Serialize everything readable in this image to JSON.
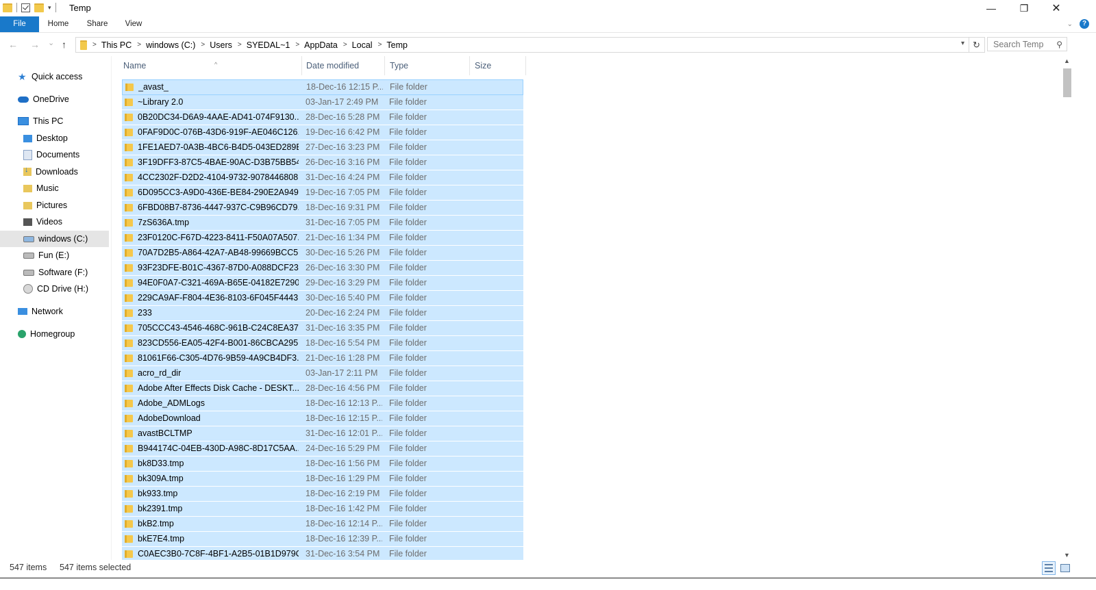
{
  "window": {
    "title": "Temp",
    "minimize": "—",
    "maximize": "❐",
    "close": "✕"
  },
  "ribbon": {
    "tabs": [
      "File",
      "Home",
      "Share",
      "View"
    ]
  },
  "nav": {
    "back": "←",
    "forward": "→",
    "recent": "⌄",
    "up": "↑"
  },
  "address": {
    "crumbs": [
      "This PC",
      "windows (C:)",
      "Users",
      "SYEDAL~1",
      "AppData",
      "Local",
      "Temp"
    ]
  },
  "search": {
    "placeholder": "Search Temp"
  },
  "sidebar": {
    "items": [
      {
        "label": "Quick access"
      },
      {
        "label": "OneDrive"
      },
      {
        "label": "This PC"
      },
      {
        "label": "Desktop"
      },
      {
        "label": "Documents"
      },
      {
        "label": "Downloads"
      },
      {
        "label": "Music"
      },
      {
        "label": "Pictures"
      },
      {
        "label": "Videos"
      },
      {
        "label": "windows (C:)"
      },
      {
        "label": "Fun (E:)"
      },
      {
        "label": "Software (F:)"
      },
      {
        "label": "CD Drive (H:)"
      },
      {
        "label": "Network"
      },
      {
        "label": "Homegroup"
      }
    ]
  },
  "columns": [
    "Name",
    "Date modified",
    "Type",
    "Size"
  ],
  "files": [
    {
      "name": "_avast_",
      "date": "18-Dec-16 12:15 P...",
      "type": "File folder"
    },
    {
      "name": "~Library 2.0",
      "date": "03-Jan-17 2:49 PM",
      "type": "File folder"
    },
    {
      "name": "0B20DC34-D6A9-4AAE-AD41-074F9130...",
      "date": "28-Dec-16 5:28 PM",
      "type": "File folder"
    },
    {
      "name": "0FAF9D0C-076B-43D6-919F-AE046C126...",
      "date": "19-Dec-16 6:42 PM",
      "type": "File folder"
    },
    {
      "name": "1FE1AED7-0A3B-4BC6-B4D5-043ED289B...",
      "date": "27-Dec-16 3:23 PM",
      "type": "File folder"
    },
    {
      "name": "3F19DFF3-87C5-4BAE-90AC-D3B75BB54...",
      "date": "26-Dec-16 3:16 PM",
      "type": "File folder"
    },
    {
      "name": "4CC2302F-D2D2-4104-9732-9078446808...",
      "date": "31-Dec-16 4:24 PM",
      "type": "File folder"
    },
    {
      "name": "6D095CC3-A9D0-436E-BE84-290E2A949...",
      "date": "19-Dec-16 7:05 PM",
      "type": "File folder"
    },
    {
      "name": "6FBD08B7-8736-4447-937C-C9B96CD79...",
      "date": "18-Dec-16 9:31 PM",
      "type": "File folder"
    },
    {
      "name": "7zS636A.tmp",
      "date": "31-Dec-16 7:05 PM",
      "type": "File folder"
    },
    {
      "name": "23F0120C-F67D-4223-8411-F50A07A507...",
      "date": "21-Dec-16 1:34 PM",
      "type": "File folder"
    },
    {
      "name": "70A7D2B5-A864-42A7-AB48-99669BCC5...",
      "date": "30-Dec-16 5:26 PM",
      "type": "File folder"
    },
    {
      "name": "93F23DFE-B01C-4367-87D0-A088DCF23...",
      "date": "26-Dec-16 3:30 PM",
      "type": "File folder"
    },
    {
      "name": "94E0F0A7-C321-469A-B65E-04182E7290...",
      "date": "29-Dec-16 3:29 PM",
      "type": "File folder"
    },
    {
      "name": "229CA9AF-F804-4E36-8103-6F045F4443...",
      "date": "30-Dec-16 5:40 PM",
      "type": "File folder"
    },
    {
      "name": "233",
      "date": "20-Dec-16 2:24 PM",
      "type": "File folder"
    },
    {
      "name": "705CCC43-4546-468C-961B-C24C8EA379...",
      "date": "31-Dec-16 3:35 PM",
      "type": "File folder"
    },
    {
      "name": "823CD556-EA05-42F4-B001-86CBCA295...",
      "date": "18-Dec-16 5:54 PM",
      "type": "File folder"
    },
    {
      "name": "81061F66-C305-4D76-9B59-4A9CB4DF3...",
      "date": "21-Dec-16 1:28 PM",
      "type": "File folder"
    },
    {
      "name": "acro_rd_dir",
      "date": "03-Jan-17 2:11 PM",
      "type": "File folder"
    },
    {
      "name": "Adobe After Effects Disk Cache - DESKT...",
      "date": "28-Dec-16 4:56 PM",
      "type": "File folder"
    },
    {
      "name": "Adobe_ADMLogs",
      "date": "18-Dec-16 12:13 P...",
      "type": "File folder"
    },
    {
      "name": "AdobeDownload",
      "date": "18-Dec-16 12:15 P...",
      "type": "File folder"
    },
    {
      "name": "avastBCLTMP",
      "date": "31-Dec-16 12:01 P...",
      "type": "File folder"
    },
    {
      "name": "B944174C-04EB-430D-A98C-8D17C5AA...",
      "date": "24-Dec-16 5:29 PM",
      "type": "File folder"
    },
    {
      "name": "bk8D33.tmp",
      "date": "18-Dec-16 1:56 PM",
      "type": "File folder"
    },
    {
      "name": "bk309A.tmp",
      "date": "18-Dec-16 1:29 PM",
      "type": "File folder"
    },
    {
      "name": "bk933.tmp",
      "date": "18-Dec-16 2:19 PM",
      "type": "File folder"
    },
    {
      "name": "bk2391.tmp",
      "date": "18-Dec-16 1:42 PM",
      "type": "File folder"
    },
    {
      "name": "bkB2.tmp",
      "date": "18-Dec-16 12:14 P...",
      "type": "File folder"
    },
    {
      "name": "bkE7E4.tmp",
      "date": "18-Dec-16 12:39 P...",
      "type": "File folder"
    },
    {
      "name": "C0AEC3B0-7C8F-4BF1-A2B5-01B1D979C...",
      "date": "31-Dec-16 3:54 PM",
      "type": "File folder"
    }
  ],
  "status": {
    "count": "547 items",
    "selected": "547 items selected"
  },
  "colors": {
    "accent": "#1979ca",
    "selection": "#cce8ff",
    "selection_border": "#99d1ff"
  }
}
